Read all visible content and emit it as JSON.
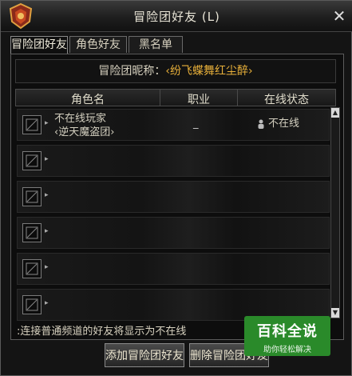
{
  "window": {
    "title": "冒险团好友 (L)",
    "close_label": "✕"
  },
  "tabs": [
    {
      "label": "冒险团好友",
      "active": true
    },
    {
      "label": "角色好友",
      "active": false
    },
    {
      "label": "黑名单",
      "active": false
    }
  ],
  "nickname": {
    "label": "冒险团昵称：",
    "value": "‹纷飞蝶舞红尘醉›"
  },
  "table": {
    "columns": [
      "角色名",
      "职业",
      "在线状态"
    ],
    "rows": [
      {
        "name_line1": "不在线玩家",
        "name_line2": "‹逆天魔盗团›",
        "job": "_",
        "status": "不在线"
      },
      {
        "name_line1": "",
        "name_line2": "",
        "job": "",
        "status": ""
      },
      {
        "name_line1": "",
        "name_line2": "",
        "job": "",
        "status": ""
      },
      {
        "name_line1": "",
        "name_line2": "",
        "job": "",
        "status": ""
      },
      {
        "name_line1": "",
        "name_line2": "",
        "job": "",
        "status": ""
      },
      {
        "name_line1": "",
        "name_line2": "",
        "job": "",
        "status": ""
      }
    ]
  },
  "hint": ":连接普通频道的好友将显示为不在线",
  "buttons": {
    "add": "添加冒险团好友",
    "delete": "删除冒险团好友"
  },
  "watermark": {
    "title": "百科全说",
    "subtitle": "助你轻松解决"
  },
  "colors": {
    "accent_gold": "#e8b03a",
    "watermark_green": "#2a8a2a"
  }
}
